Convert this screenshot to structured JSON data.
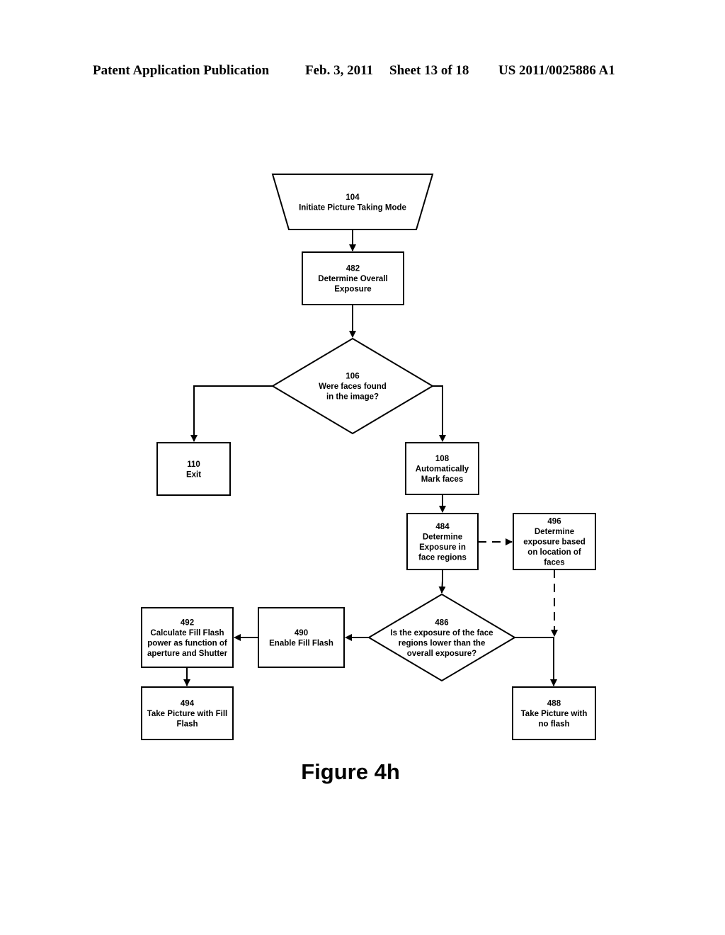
{
  "header": {
    "publication": "Patent Application Publication",
    "date": "Feb. 3, 2011",
    "sheet": "Sheet 13 of 18",
    "number": "US 2011/0025886 A1"
  },
  "figure_label": "Figure 4h",
  "nodes": {
    "n104": {
      "id": "104",
      "lines": [
        "Initiate Picture Taking Mode"
      ],
      "shape": "trapezoid"
    },
    "n482": {
      "id": "482",
      "lines": [
        "Determine Overall",
        "Exposure"
      ],
      "shape": "process"
    },
    "n106": {
      "id": "106",
      "lines": [
        "Were faces found",
        "in the image?"
      ],
      "shape": "decision"
    },
    "n110": {
      "id": "110",
      "lines": [
        "Exit"
      ],
      "shape": "process"
    },
    "n108": {
      "id": "108",
      "lines": [
        "Automatically",
        "Mark faces"
      ],
      "shape": "process"
    },
    "n484": {
      "id": "484",
      "lines": [
        "Determine",
        "Exposure in",
        "face regions"
      ],
      "shape": "process"
    },
    "n496": {
      "id": "496",
      "lines": [
        "Determine",
        "exposure based",
        "on location of",
        "faces"
      ],
      "shape": "process"
    },
    "n486": {
      "id": "486",
      "lines": [
        "Is the exposure of the face",
        "regions lower than the",
        "overall exposure?"
      ],
      "shape": "decision"
    },
    "n490": {
      "id": "490",
      "lines": [
        "Enable Fill Flash"
      ],
      "shape": "process"
    },
    "n492": {
      "id": "492",
      "lines": [
        "Calculate Fill Flash",
        "power as function of",
        "aperture and Shutter"
      ],
      "shape": "process"
    },
    "n494": {
      "id": "494",
      "lines": [
        "Take Picture with Fill",
        "Flash"
      ],
      "shape": "process"
    },
    "n488": {
      "id": "488",
      "lines": [
        "Take Picture with",
        "no flash"
      ],
      "shape": "process"
    }
  },
  "edges": [
    {
      "from": "104",
      "to": "482",
      "style": "solid"
    },
    {
      "from": "482",
      "to": "106",
      "style": "solid"
    },
    {
      "from": "106",
      "to": "110",
      "style": "solid"
    },
    {
      "from": "106",
      "to": "108",
      "style": "solid"
    },
    {
      "from": "108",
      "to": "484",
      "style": "solid"
    },
    {
      "from": "484",
      "to": "496",
      "style": "dashed"
    },
    {
      "from": "484",
      "to": "486",
      "style": "solid"
    },
    {
      "from": "496",
      "to": "488",
      "style": "dashed"
    },
    {
      "from": "486",
      "to": "490",
      "style": "solid"
    },
    {
      "from": "486",
      "to": "488",
      "style": "solid"
    },
    {
      "from": "490",
      "to": "492",
      "style": "solid"
    },
    {
      "from": "492",
      "to": "494",
      "style": "solid"
    }
  ]
}
